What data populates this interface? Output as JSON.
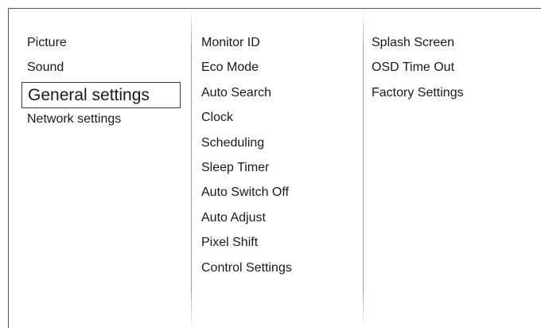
{
  "menu": {
    "level1": [
      {
        "label": "Picture"
      },
      {
        "label": "Sound"
      },
      {
        "label": "General settings",
        "selected": true
      },
      {
        "label": "Network settings"
      }
    ],
    "level2": [
      {
        "label": "Monitor ID"
      },
      {
        "label": "Eco Mode"
      },
      {
        "label": "Auto Search"
      },
      {
        "label": "Clock"
      },
      {
        "label": "Scheduling"
      },
      {
        "label": "Sleep Timer"
      },
      {
        "label": "Auto Switch Off"
      },
      {
        "label": "Auto Adjust"
      },
      {
        "label": "Pixel Shift"
      },
      {
        "label": "Control Settings"
      }
    ],
    "level3": [
      {
        "label": "Splash Screen"
      },
      {
        "label": "OSD Time Out"
      },
      {
        "label": "Factory Settings"
      }
    ]
  },
  "colors": {
    "background": "#ffffff",
    "text": "#1a1a1a",
    "selection_border": "#3c3c3c",
    "divider": "#969696"
  }
}
